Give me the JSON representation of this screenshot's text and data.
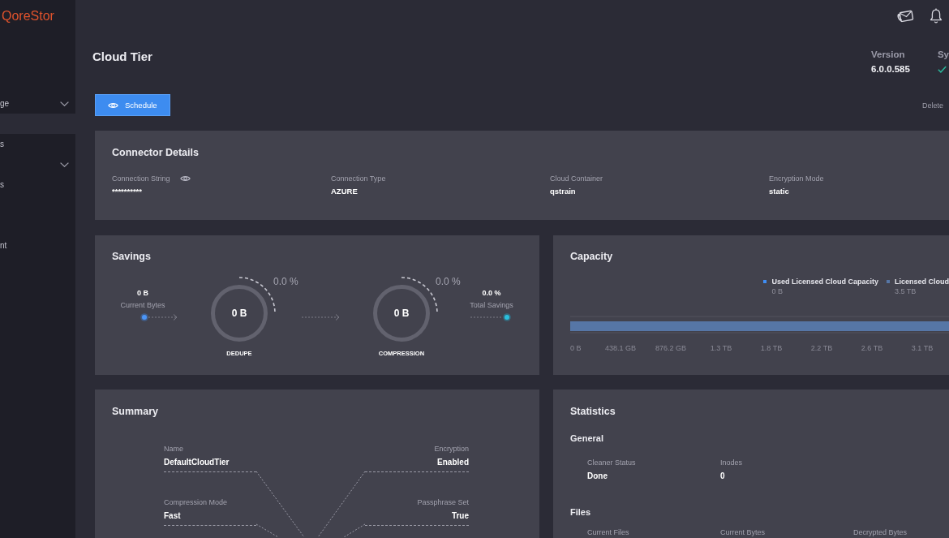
{
  "app": {
    "logo": "QoreStor"
  },
  "sidebar": {
    "items": [
      {
        "label": "ge",
        "expandable": true,
        "selected": false
      },
      {
        "expandable": false,
        "selected": true
      },
      {
        "label": "s",
        "expandable": false,
        "selected": false
      },
      {
        "expandable": true,
        "selected": false
      },
      {
        "label": "s",
        "expandable": false,
        "selected": false
      },
      {
        "label": "nt",
        "expandable": false,
        "selected": false
      }
    ]
  },
  "page": {
    "title": "Cloud Tier",
    "header_stats": [
      {
        "label": "Version",
        "kind": "text",
        "value": "6.0.0.585"
      },
      {
        "label": "Sy",
        "kind": "status",
        "ok": true
      }
    ]
  },
  "actions": [
    {
      "label": "Schedule",
      "kind": "primary"
    },
    {
      "label": "Delete",
      "kind": "text"
    }
  ],
  "connector_details": {
    "title": "Connector Details",
    "fields": [
      {
        "label": "Connection String",
        "value": "**********",
        "revealable": true
      },
      {
        "label": "Connection Type",
        "value": "AZURE",
        "revealable": false
      },
      {
        "label": "Cloud Container",
        "value": "qstrain",
        "revealable": false
      },
      {
        "label": "Encryption Mode",
        "value": "static",
        "revealable": false
      }
    ]
  },
  "savings": {
    "title": "Savings",
    "source": {
      "value": "0 B",
      "label": "Current Bytes"
    },
    "stages": [
      {
        "value": "0 B",
        "percent": "0.0 %",
        "label": "DEDUPE"
      },
      {
        "value": "0 B",
        "percent": "0.0 %",
        "label": "COMPRESSION"
      }
    ],
    "result": {
      "value": "0.0 %",
      "label": "Total Savings"
    }
  },
  "capacity": {
    "title": "Capacity",
    "legend": [
      {
        "name": "Used Licensed Cloud Capacity",
        "reading": "0 B",
        "color": "#3f8ef5"
      },
      {
        "name": "Licensed Cloud",
        "reading": "3.5 TB",
        "color": "#5676a6"
      }
    ],
    "axis_labels": [
      "0 B",
      "438.1 GB",
      "876.2 GB",
      "1.3 TB",
      "1.8 TB",
      "2.2 TB",
      "2.6 TB",
      "3.1 TB"
    ]
  },
  "summary": {
    "title": "Summary",
    "fields": [
      {
        "label": "Name",
        "value": "DefaultCloudTier"
      },
      {
        "label": "Encryption",
        "value": "Enabled"
      },
      {
        "label": "Compression Mode",
        "value": "Fast"
      },
      {
        "label": "Passphrase Set",
        "value": "True"
      }
    ]
  },
  "statistics": {
    "title": "Statistics",
    "sections": [
      {
        "title": "General",
        "fields": [
          {
            "label": "Cleaner Status",
            "value": "Done"
          },
          {
            "label": "Inodes",
            "value": "0"
          }
        ]
      },
      {
        "title": "Files",
        "fields": [
          {
            "label": "Current Files"
          },
          {
            "label": "Current Bytes"
          },
          {
            "label": "Decrypted Bytes"
          }
        ]
      }
    ]
  }
}
